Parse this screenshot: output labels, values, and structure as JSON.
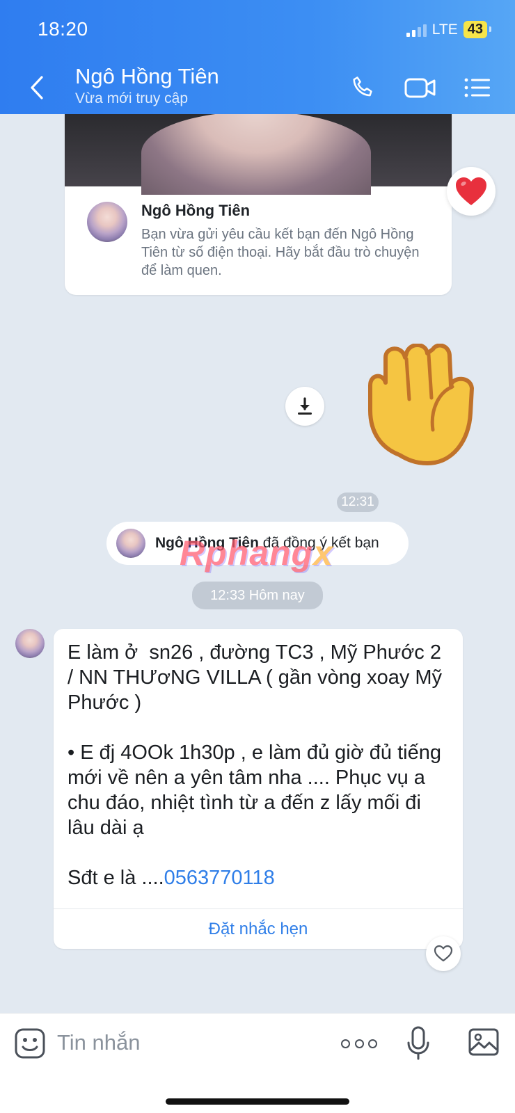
{
  "status_bar": {
    "time": "18:20",
    "network": "LTE",
    "battery": "43"
  },
  "header": {
    "contact_name": "Ngô Hồng Tiên",
    "contact_status": "Vừa mới truy cập"
  },
  "profile_card": {
    "name": "Ngô Hồng Tiên",
    "text": "Bạn vừa gửi yêu cầu kết bạn đến Ngô Hồng Tiên từ số điện thoại. Hãy bắt đầu trò chuyện để làm quen."
  },
  "timestamps": {
    "first": "12:31",
    "second": "12:33 Hôm nay"
  },
  "friend_notice": {
    "name": "Ngô Hồng Tiên",
    "text": " đã đồng ý kết bạn"
  },
  "watermark": {
    "main": "Rphang",
    "suffix": "x"
  },
  "message": {
    "text": "E làm ở  sn26 , đường TC3 , Mỹ Phước 2 / NN THƯơNG VILLA ( gần vòng xoay Mỹ Phước )\n\n• E đj 4OOk 1h30p , e làm đủ giờ đủ tiếng mới về nên a yên tâm nha .... Phục vụ a chu đáo, nhiệt tình từ a đến z lấy mối đi lâu dài ạ\n\nSđt e là ....",
    "phone": "0563770118",
    "action": "Đặt nhắc hẹn"
  },
  "composer": {
    "placeholder": "Tin nhắn"
  },
  "colors": {
    "accent": "#2f7ee8",
    "header": "#3c8ef3",
    "background": "#e2e9f1"
  }
}
